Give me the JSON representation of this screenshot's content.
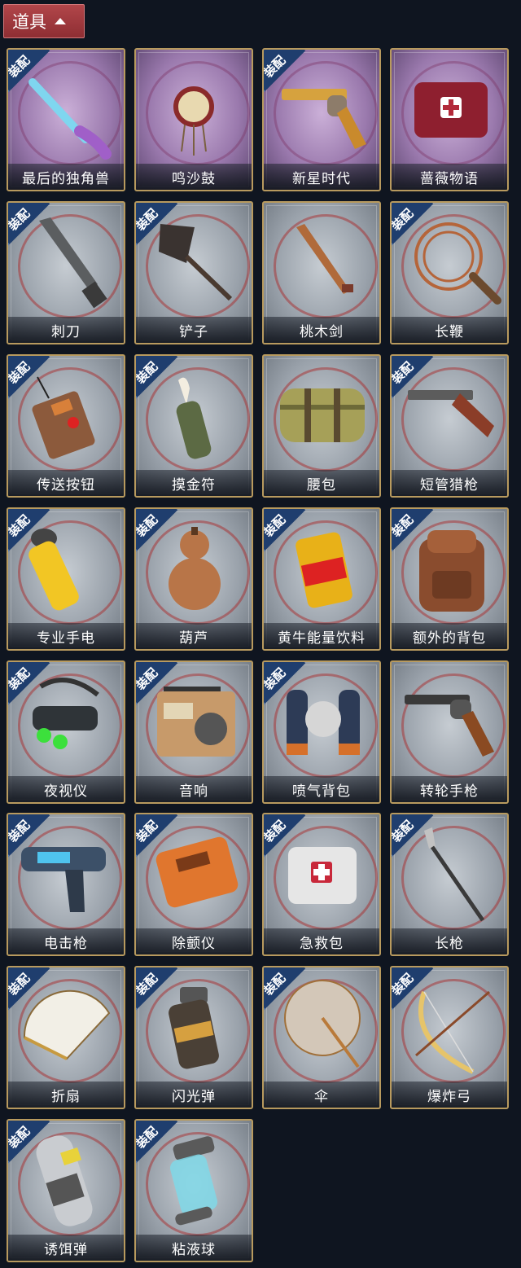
{
  "header": {
    "title": "道具",
    "caret_icon": "chevron-up-icon"
  },
  "colors": {
    "card_border": "#b89a5e",
    "badge": "#1f3e6e",
    "header": "#a33d42"
  },
  "items": [
    {
      "name": "最后的独角兽",
      "equipped": true,
      "rarity": "purple",
      "icon": "unicorn-dagger-icon"
    },
    {
      "name": "鸣沙鼓",
      "equipped": false,
      "rarity": "purple",
      "icon": "sand-drum-icon"
    },
    {
      "name": "新星时代",
      "equipped": true,
      "rarity": "purple",
      "icon": "gold-revolver-icon"
    },
    {
      "name": "蔷薇物语",
      "equipped": false,
      "rarity": "purple",
      "icon": "rose-medkit-icon"
    },
    {
      "name": "刺刀",
      "equipped": true,
      "rarity": "grey",
      "icon": "bayonet-icon"
    },
    {
      "name": "铲子",
      "equipped": true,
      "rarity": "grey",
      "icon": "shovel-icon"
    },
    {
      "name": "桃木剑",
      "equipped": false,
      "rarity": "grey",
      "icon": "wooden-sword-icon"
    },
    {
      "name": "长鞭",
      "equipped": true,
      "rarity": "grey",
      "icon": "whip-icon"
    },
    {
      "name": "传送按钮",
      "equipped": true,
      "rarity": "grey",
      "icon": "teleport-button-icon"
    },
    {
      "name": "摸金符",
      "equipped": true,
      "rarity": "grey",
      "icon": "tooth-amulet-icon"
    },
    {
      "name": "腰包",
      "equipped": false,
      "rarity": "grey",
      "icon": "waist-bag-icon"
    },
    {
      "name": "短管猎枪",
      "equipped": true,
      "rarity": "grey",
      "icon": "sawed-off-shotgun-icon"
    },
    {
      "name": "专业手电",
      "equipped": true,
      "rarity": "grey",
      "icon": "flashlight-icon"
    },
    {
      "name": "葫芦",
      "equipped": true,
      "rarity": "grey",
      "icon": "gourd-icon"
    },
    {
      "name": "黄牛能量饮料",
      "equipped": true,
      "rarity": "grey",
      "icon": "energy-drink-icon"
    },
    {
      "name": "额外的背包",
      "equipped": true,
      "rarity": "grey",
      "icon": "backpack-icon"
    },
    {
      "name": "夜视仪",
      "equipped": true,
      "rarity": "grey",
      "icon": "night-vision-icon"
    },
    {
      "name": "音响",
      "equipped": true,
      "rarity": "grey",
      "icon": "radio-icon"
    },
    {
      "name": "喷气背包",
      "equipped": true,
      "rarity": "grey",
      "icon": "jetpack-icon"
    },
    {
      "name": "转轮手枪",
      "equipped": false,
      "rarity": "grey",
      "icon": "revolver-icon"
    },
    {
      "name": "电击枪",
      "equipped": true,
      "rarity": "grey",
      "icon": "stun-gun-icon"
    },
    {
      "name": "除颤仪",
      "equipped": true,
      "rarity": "grey",
      "icon": "defibrillator-icon"
    },
    {
      "name": "急救包",
      "equipped": true,
      "rarity": "grey",
      "icon": "first-aid-kit-icon"
    },
    {
      "name": "长枪",
      "equipped": true,
      "rarity": "grey",
      "icon": "spear-icon"
    },
    {
      "name": "折扇",
      "equipped": true,
      "rarity": "grey",
      "icon": "folding-fan-icon"
    },
    {
      "name": "闪光弹",
      "equipped": true,
      "rarity": "grey",
      "icon": "flashbang-icon"
    },
    {
      "name": "伞",
      "equipped": true,
      "rarity": "grey",
      "icon": "umbrella-icon"
    },
    {
      "name": "爆炸弓",
      "equipped": true,
      "rarity": "grey",
      "icon": "explosive-bow-icon"
    },
    {
      "name": "诱饵弹",
      "equipped": true,
      "rarity": "grey",
      "icon": "decoy-grenade-icon"
    },
    {
      "name": "粘液球",
      "equipped": true,
      "rarity": "grey",
      "icon": "slime-ball-icon"
    }
  ],
  "badge_label": "装配"
}
